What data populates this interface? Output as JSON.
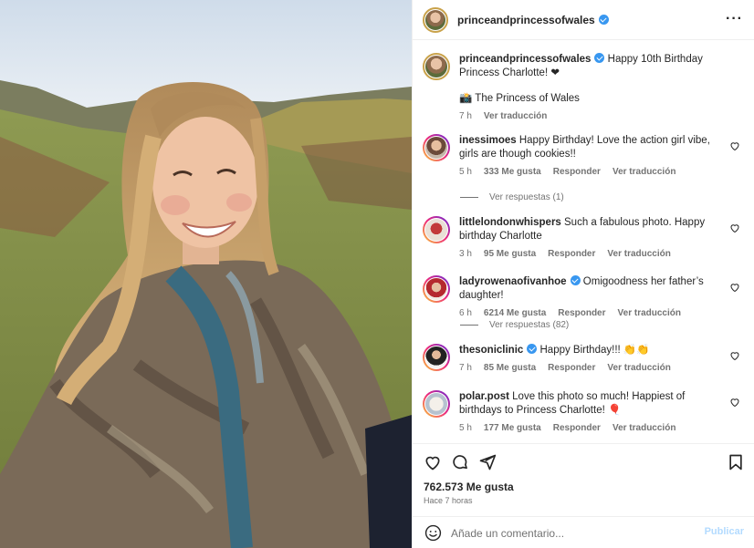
{
  "post": {
    "author": "princeandprincessofwales",
    "verified": true,
    "caption_text": "Happy 10th Birthday Princess Charlotte! ❤",
    "caption_signature": "📸 The Princess of Wales",
    "caption_time": "7 h",
    "caption_translate": "Ver traducción",
    "likes": "762.573 Me gusta",
    "posted_ago": "Hace 7 horas"
  },
  "comments": [
    {
      "username": "inessimoes",
      "verified": false,
      "text": "Happy Birthday! Love the action girl vibe, girls are though cookies!!",
      "time": "5 h",
      "likes": "333 Me gusta",
      "reply": "Responder",
      "translate": "Ver traducción",
      "replies": "Ver respuestas (1)"
    },
    {
      "username": "littlelondonwhispers",
      "verified": false,
      "text": "Such a fabulous photo. Happy birthday Charlotte",
      "time": "3 h",
      "likes": "95 Me gusta",
      "reply": "Responder",
      "translate": "Ver traducción"
    },
    {
      "username": "ladyrowenaofivanhoe",
      "verified": true,
      "text": "Omigoodness her father’s daughter!",
      "time": "6 h",
      "likes": "6214 Me gusta",
      "reply": "Responder",
      "translate": "Ver traducción",
      "replies": "Ver respuestas (82)"
    },
    {
      "username": "thesoniclinic",
      "verified": true,
      "text": "Happy Birthday!!! 👏👏",
      "time": "7 h",
      "likes": "85 Me gusta",
      "reply": "Responder",
      "translate": "Ver traducción"
    },
    {
      "username": "polar.post",
      "verified": false,
      "text": "Love this photo so much! Happiest of birthdays to Princess Charlotte! 🎈",
      "time": "5 h",
      "likes": "177 Me gusta",
      "reply": "Responder",
      "translate": "Ver traducción"
    }
  ],
  "composer": {
    "placeholder": "Añade un comentario...",
    "publish_label": "Publicar"
  },
  "icons": {
    "more": "more-options-icon",
    "like": "heart-icon",
    "comment": "comment-icon",
    "share": "share-icon",
    "save": "bookmark-icon",
    "emoji": "emoji-icon"
  },
  "colors": {
    "verified": "#3897f0",
    "muted_text": "#737373",
    "publish_disabled": "#b3dbff"
  }
}
